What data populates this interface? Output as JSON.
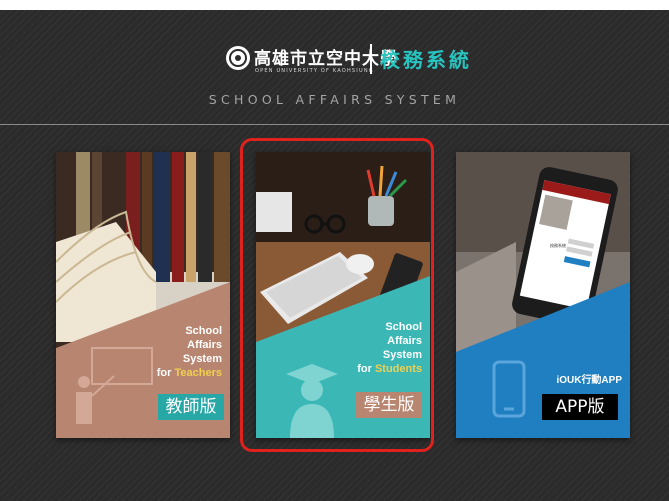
{
  "header": {
    "university_name": "高雄市立空中大學",
    "university_subtitle": "OPEN UNIVERSITY OF KAOHSIUNG",
    "system_title": "校務系統",
    "system_subtitle": "SCHOOL AFFAIRS SYSTEM"
  },
  "cards": [
    {
      "key": "teacher",
      "line1": "School",
      "line2": "Affairs",
      "line3": "System",
      "for_prefix": "for",
      "audience": "Teachers",
      "label": "教師版",
      "colors": {
        "overlay": "#b88571",
        "label_bg": "#27a8a6"
      }
    },
    {
      "key": "student",
      "line1": "School",
      "line2": "Affairs",
      "line3": "System",
      "for_prefix": "for",
      "audience": "Students",
      "label": "學生版",
      "colors": {
        "overlay": "#3bb8b6",
        "label_bg": "#b88571"
      }
    },
    {
      "key": "app",
      "line1": "iOUK行動APP",
      "label": "APP版",
      "phone_screen_title": "校務系統",
      "colors": {
        "overlay": "#1f7fc0",
        "label_bg": "#000000"
      }
    }
  ],
  "selected_card": "student",
  "colors": {
    "accent": "#27c4c0",
    "highlight_ring": "#e0221f",
    "background": "#2b2b2b"
  }
}
